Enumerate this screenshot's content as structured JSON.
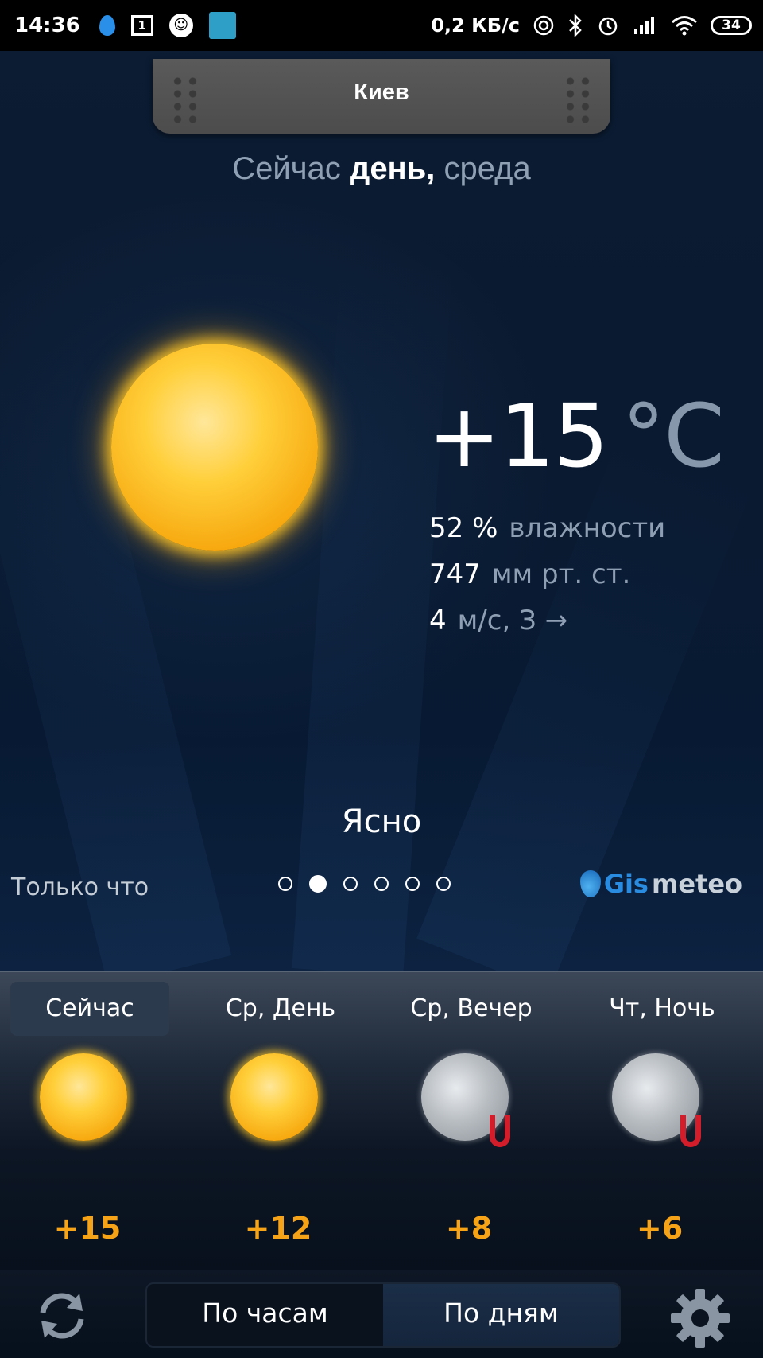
{
  "status_bar": {
    "time": "14:36",
    "calendar_day": "1",
    "speed": "0,2 КБ/с",
    "battery": "34",
    "icons": [
      "water-drop-icon",
      "calendar-icon",
      "troll-face-icon",
      "app-icon",
      "hotspot-icon",
      "bluetooth-icon",
      "alarm-icon",
      "signal-icon",
      "wifi-icon",
      "battery-icon"
    ]
  },
  "header": {
    "city": "Киев",
    "now_prefix": "Сейчас",
    "now_period": "день,",
    "now_weekday": "среда"
  },
  "current": {
    "temperature": "+15",
    "unit": "°C",
    "humidity_value": "52 %",
    "humidity_label": "влажности",
    "pressure_value": "747",
    "pressure_label": "мм рт. ст.",
    "wind_value": "4",
    "wind_label": "м/с, З →",
    "condition": "Ясно",
    "weather_icon": "sun-icon"
  },
  "footer_info": {
    "updated": "Только что",
    "page_dots": 6,
    "active_dot": 1,
    "logo_gis": "Gis",
    "logo_meteo": "meteo"
  },
  "forecast": [
    {
      "label": "Сейчас",
      "temp": "+15",
      "icon": "sun-icon",
      "selected": true
    },
    {
      "label": "Ср, День",
      "temp": "+12",
      "icon": "sun-icon",
      "selected": false
    },
    {
      "label": "Ср, Вечер",
      "temp": "+8",
      "icon": "moon-icon",
      "selected": false
    },
    {
      "label": "Чт, Ночь",
      "temp": "+6",
      "icon": "moon-icon",
      "selected": false
    }
  ],
  "bottom_bar": {
    "hourly_label": "По часам",
    "daily_label": "По дням",
    "active": "daily"
  },
  "colors": {
    "accent_temp": "#f7a318",
    "background": "#0a1a30",
    "muted_text": "#8fa0b4"
  }
}
